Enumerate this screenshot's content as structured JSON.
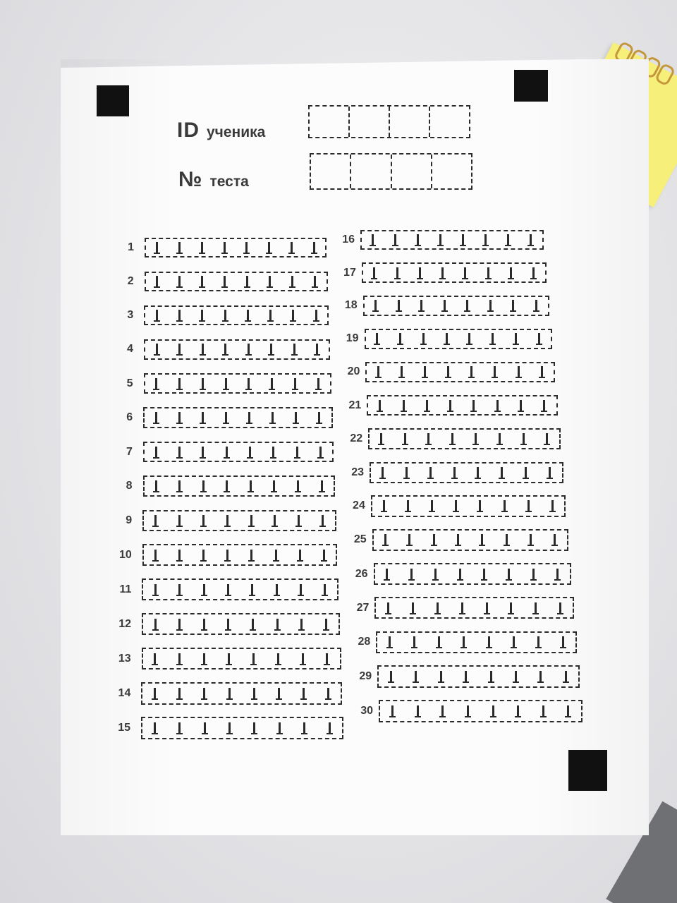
{
  "header": {
    "student_id": {
      "abbr": "ID",
      "label": "ученика"
    },
    "test_number": {
      "abbr": "№",
      "label": "теста"
    },
    "digit_boxes": 4
  },
  "questions": {
    "count": 30,
    "answer_cells_per_question": 8,
    "labels": [
      "1",
      "2",
      "3",
      "4",
      "5",
      "6",
      "7",
      "8",
      "9",
      "10",
      "11",
      "12",
      "13",
      "14",
      "15",
      "16",
      "17",
      "18",
      "19",
      "20",
      "21",
      "22",
      "23",
      "24",
      "25",
      "26",
      "27",
      "28",
      "29",
      "30"
    ]
  },
  "corner_markers": [
    "top-left",
    "top-right",
    "bottom-right"
  ],
  "colors": {
    "paper": "#fcfcfd",
    "ink": "#2b2b2b",
    "marker": "#111111",
    "notepad": "#f6ef7a"
  }
}
